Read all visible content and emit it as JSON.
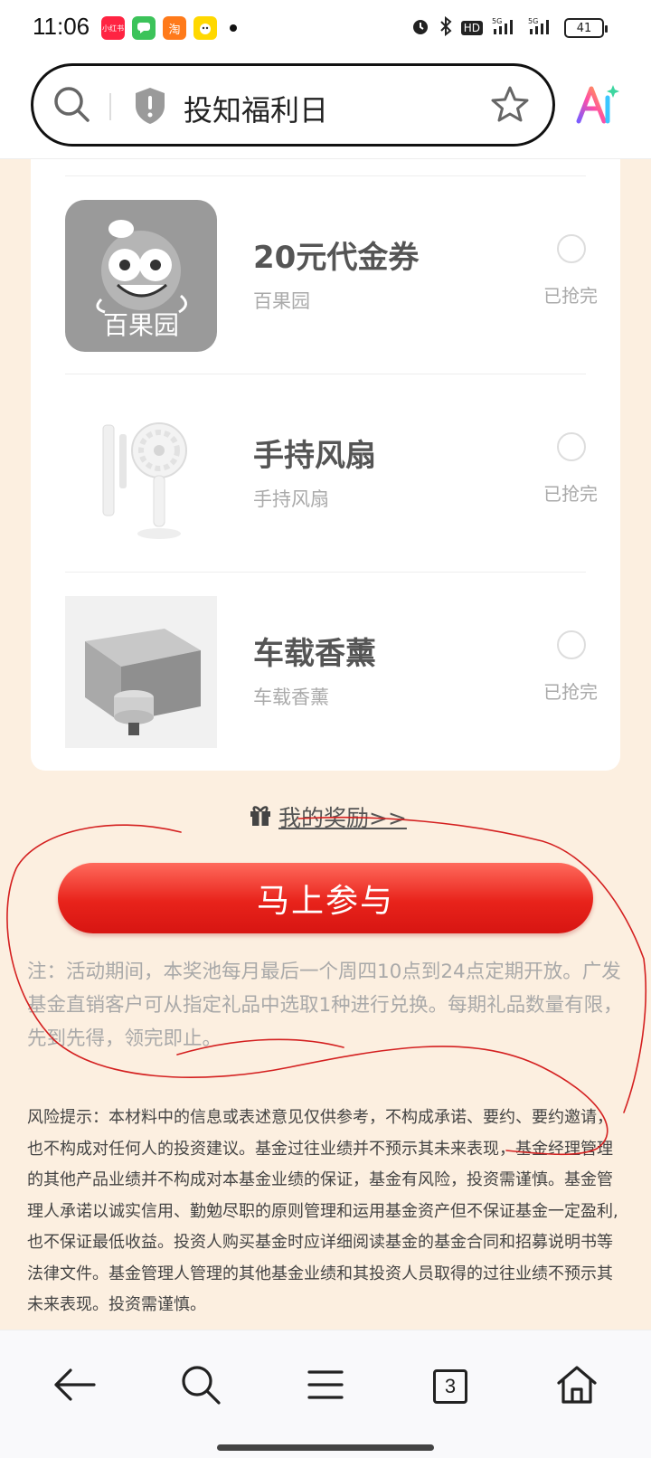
{
  "status_bar": {
    "time": "11:06",
    "apps": [
      {
        "name": "xiaohongshu-app-icon",
        "label": "小红书",
        "color": "#ff2442"
      },
      {
        "name": "messages-app-icon",
        "label": "",
        "color": "#3cc35a"
      },
      {
        "name": "taobao-app-icon",
        "label": "淘",
        "color": "#ff7a1a"
      },
      {
        "name": "game-app-icon",
        "label": "",
        "color": "#ffd800"
      }
    ],
    "network": "5G",
    "hd": "HD",
    "battery": "41"
  },
  "address_bar": {
    "search_text": "投知福利日"
  },
  "items": [
    {
      "title": "20元代金券",
      "subtitle": "百果园",
      "status": "已抢完",
      "logo_text": "百果园"
    },
    {
      "title": "手持风扇",
      "subtitle": "手持风扇",
      "status": "已抢完"
    },
    {
      "title": "车载香薰",
      "subtitle": "车载香薰",
      "status": "已抢完"
    }
  ],
  "rewards_link": "我的奖励>>",
  "join_button": "马上参与",
  "note": "注：活动期间，本奖池每月最后一个周四10点到24点定期开放。广发基金直销客户可从指定礼品中选取1种进行兑换。每期礼品数量有限，先到先得，领完即止。",
  "risk_notice": "风险提示：本材料中的信息或表述意见仅供参考，不构成承诺、要约、要约邀请，也不构成对任何人的投资建议。基金过往业绩并不预示其未来表现，基金经理管理的其他产品业绩并不构成对本基金业绩的保证，基金有风险，投资需谨慎。基金管理人承诺以诚实信用、勤勉尽职的原则管理和运用基金资产但不保证基金一定盈利,也不保证最低收益。投资人购买基金时应详细阅读基金的基金合同和招募说明书等法律文件。基金管理人管理的其他基金业绩和其投资人员取得的过往业绩不预示其未来表现。投资需谨慎。",
  "bottom_nav": {
    "tab_count": "3",
    "buttons": [
      "back-icon",
      "search-icon",
      "menu-icon",
      "tabs-icon",
      "home-icon"
    ]
  },
  "colors": {
    "page_background": "#fcefe0",
    "button_red": "#e8231b",
    "scribble_red": "#d42020"
  }
}
